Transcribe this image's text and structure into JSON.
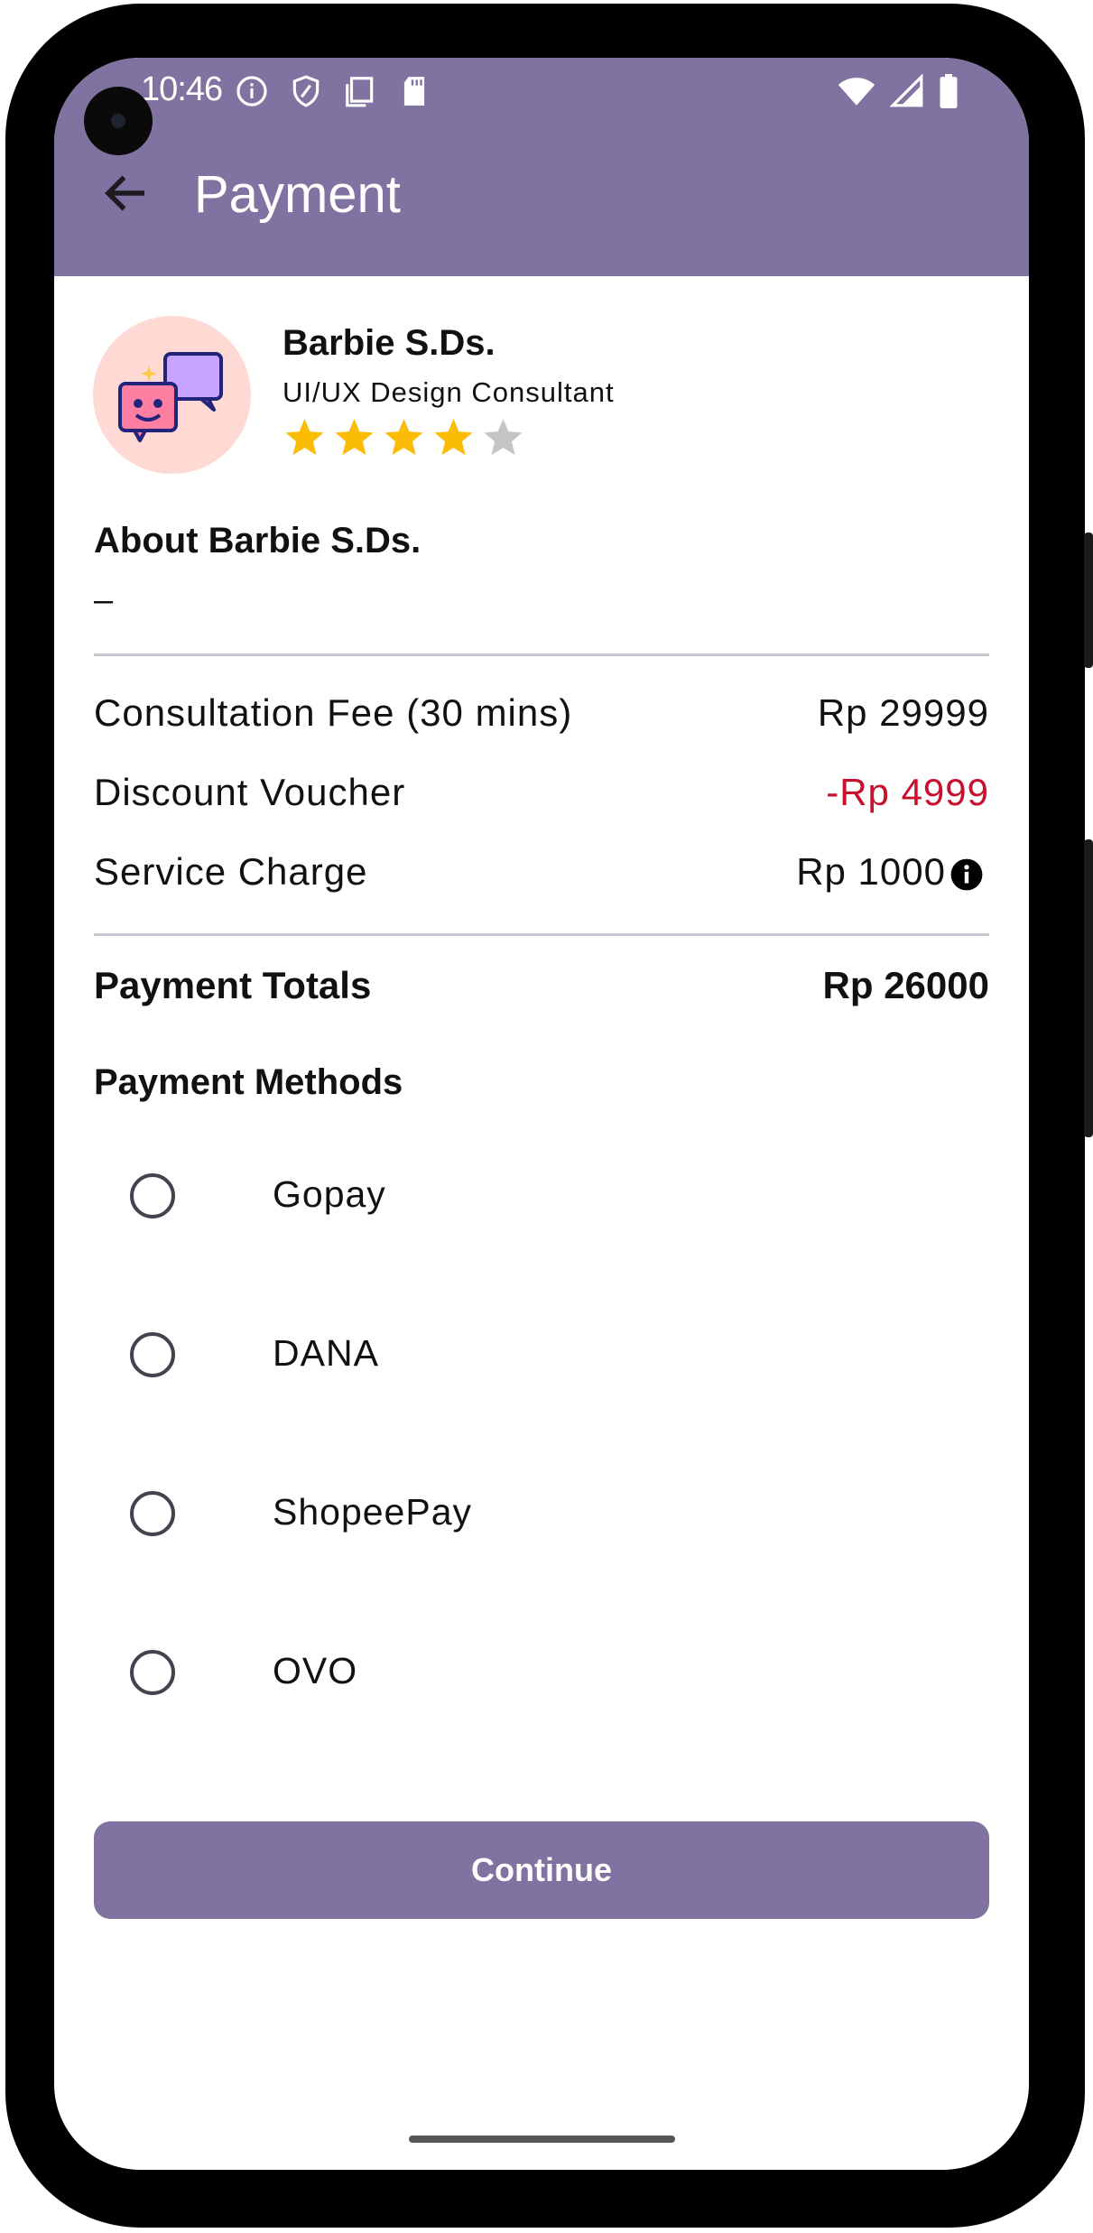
{
  "status_bar": {
    "time": "10:46"
  },
  "app_bar": {
    "title": "Payment"
  },
  "consultant": {
    "name": "Barbie S.Ds.",
    "role": "UI/UX Design Consultant",
    "rating": 4,
    "rating_max": 5,
    "avatar_icon": "chat-bubbles-icon"
  },
  "about": {
    "heading": "About Barbie S.Ds.",
    "value": "–"
  },
  "fees": {
    "consultation_label": "Consultation Fee (30 mins)",
    "consultation_value": "Rp 29999",
    "discount_label": "Discount Voucher",
    "discount_value": "-Rp 4999",
    "service_label": "Service Charge",
    "service_value": "Rp 1000",
    "total_label": "Payment Totals",
    "total_value": "Rp 26000"
  },
  "payment_methods": {
    "heading": "Payment Methods",
    "options": [
      "Gopay",
      "DANA",
      "ShopeePay",
      "OVO"
    ]
  },
  "continue_label": "Continue",
  "colors": {
    "primary": "#8073a1",
    "discount": "#c8102e",
    "star_on": "#fbbc05",
    "star_off": "#c4c4c4",
    "avatar_bg": "#ffd9d4"
  }
}
